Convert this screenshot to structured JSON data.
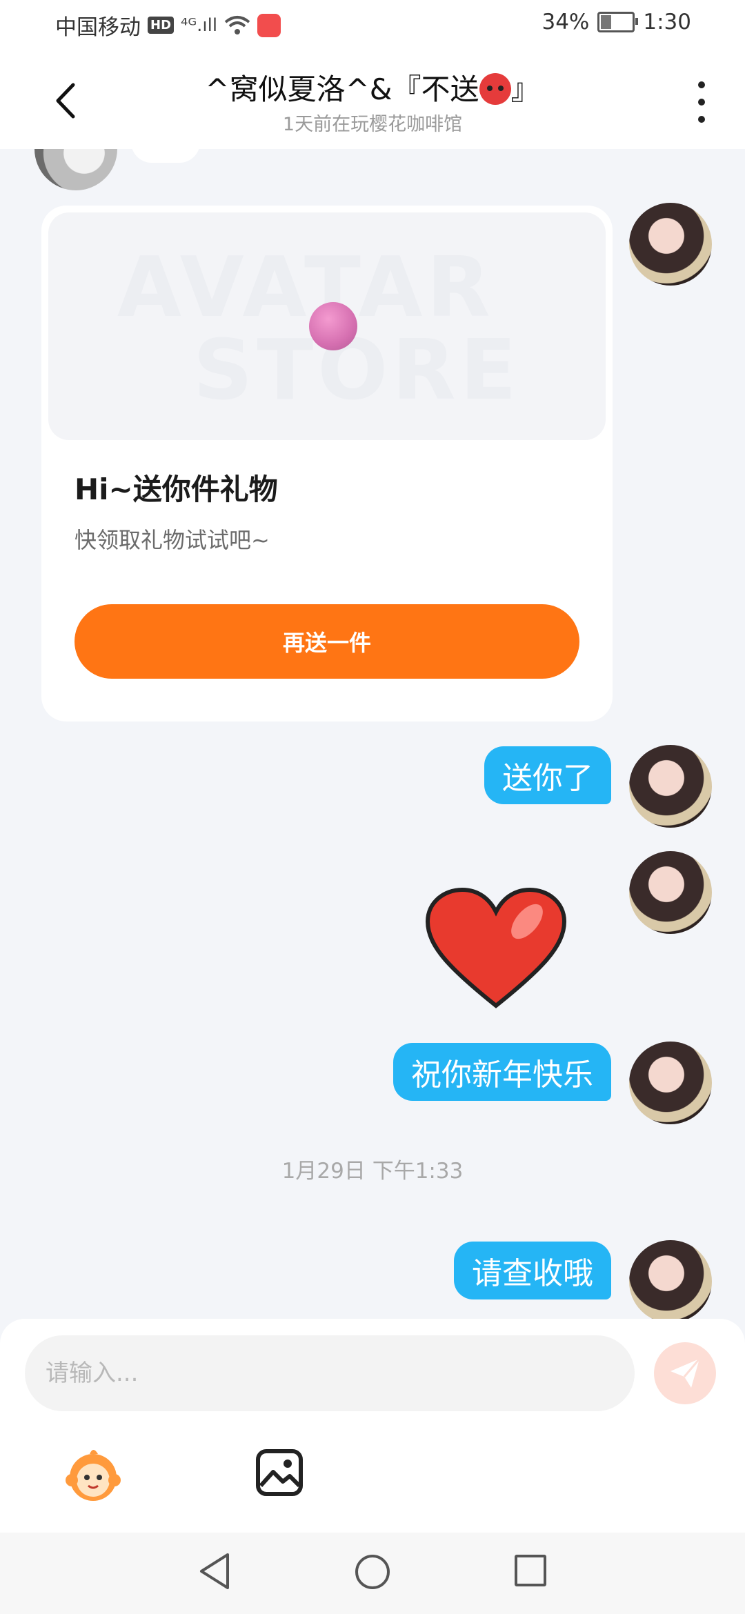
{
  "status_bar": {
    "carrier": "中国移动",
    "hd_badge": "HD",
    "signal": "⁴ᴳ.ıll",
    "battery": "34%",
    "battery_level": 0.34,
    "time": "1:30"
  },
  "header": {
    "title": "^窝似夏洛^&『不送",
    "title_suffix": "』",
    "subtitle": "1天前在玩樱花咖啡馆"
  },
  "gift_card": {
    "image_watermark_line1": "AVATAR",
    "image_watermark_line2": "STORE",
    "title": "Hi~送你件礼物",
    "description": "快领取礼物试试吧~",
    "button_label": "再送一件"
  },
  "messages": [
    {
      "text": "送你了"
    },
    {
      "text": "祝你新年快乐"
    },
    {
      "text": "请查收哦"
    }
  ],
  "timestamp": "1月29日 下午1:33",
  "input": {
    "placeholder": "请输入..."
  },
  "colors": {
    "accent_orange": "#ff7514",
    "bubble_blue": "#25b5f5",
    "send_button_bg": "#fdded6"
  }
}
